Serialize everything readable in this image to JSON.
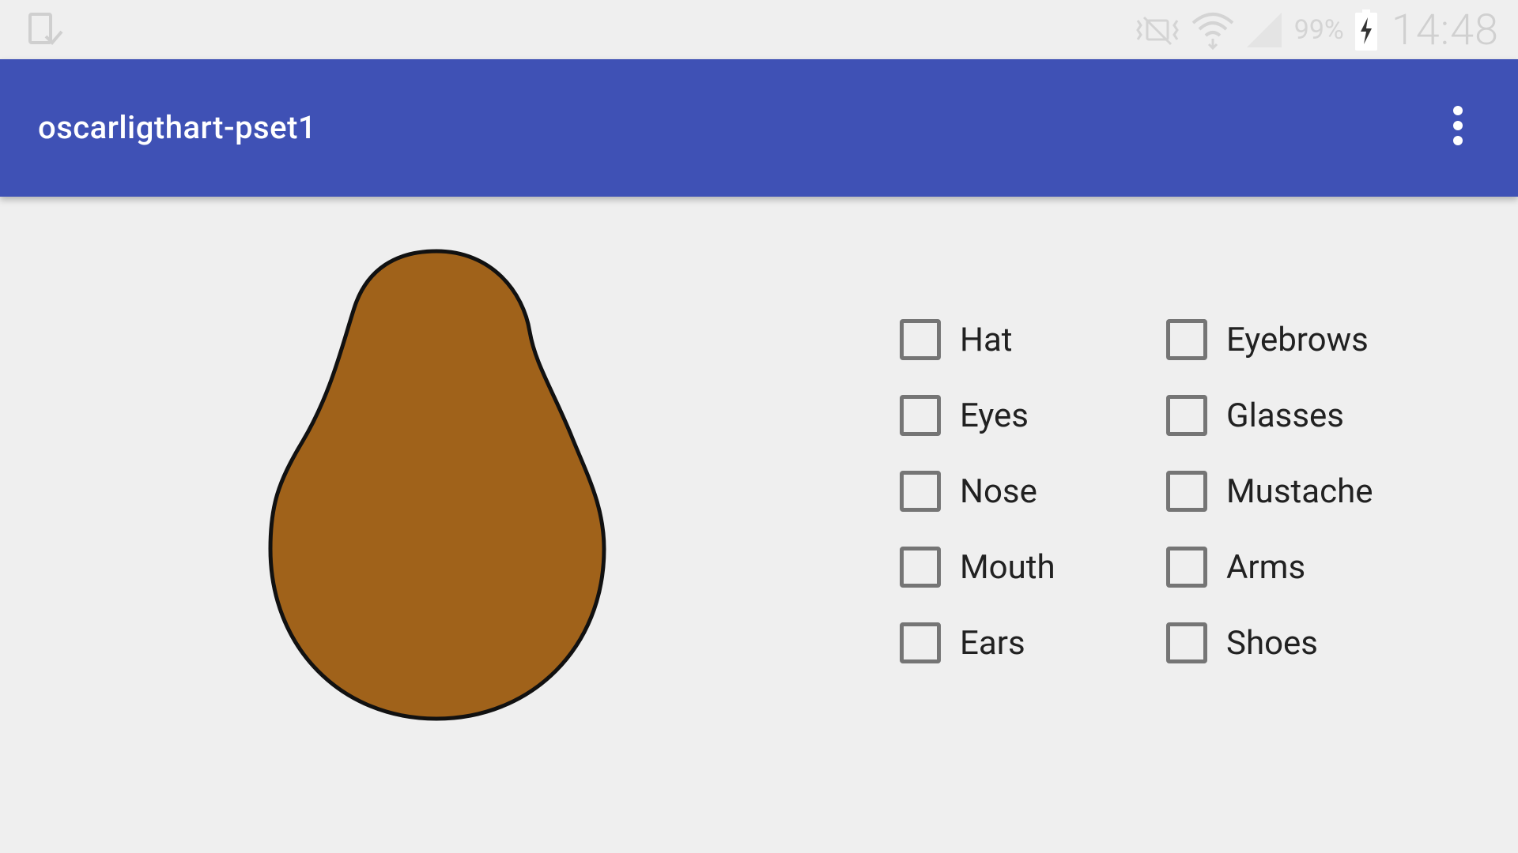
{
  "status_bar": {
    "left_icon": "download-complete-icon",
    "icons": [
      "vibrate-mute-icon",
      "wifi-icon",
      "cellular-signal-icon",
      "battery-charging-icon"
    ],
    "battery_percent": "99%",
    "time": "14:48"
  },
  "app_bar": {
    "title": "oscarligthart-pset1",
    "menu_icon": "overflow-menu-icon",
    "color": "#3f51b5"
  },
  "character": {
    "body_color": "#a0621a",
    "outline_color": "#111111"
  },
  "checkboxes": {
    "left": [
      {
        "label": "Hat",
        "checked": false
      },
      {
        "label": "Eyes",
        "checked": false
      },
      {
        "label": "Nose",
        "checked": false
      },
      {
        "label": "Mouth",
        "checked": false
      },
      {
        "label": "Ears",
        "checked": false
      }
    ],
    "right": [
      {
        "label": "Eyebrows",
        "checked": false
      },
      {
        "label": "Glasses",
        "checked": false
      },
      {
        "label": "Mustache",
        "checked": false
      },
      {
        "label": "Arms",
        "checked": false
      },
      {
        "label": "Shoes",
        "checked": false
      }
    ]
  }
}
